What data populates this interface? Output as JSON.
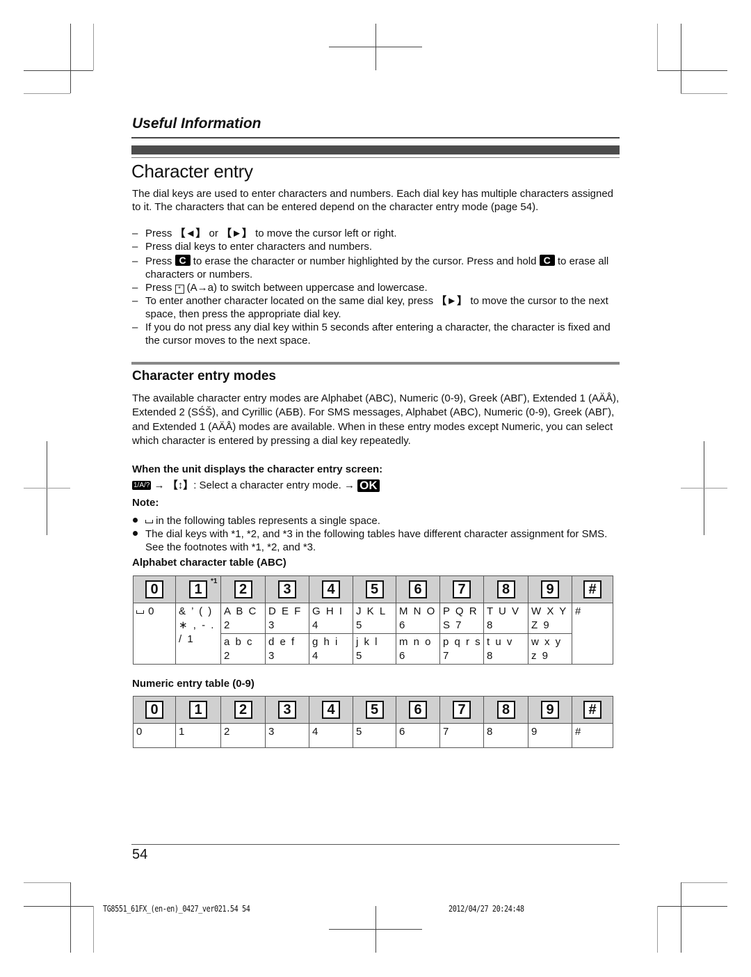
{
  "header": {
    "section_label": "Useful Information",
    "title": "Character entry"
  },
  "intro": {
    "paragraph": "The dial keys are used to enter characters and numbers. Each dial key has multiple characters assigned to it. The characters that can be entered depend on the character entry mode (page 54).",
    "bullets": [
      {
        "pre": "Press ",
        "k1": "【◄】",
        "mid": " or ",
        "k2": "【►】",
        "post": " to move the cursor left or right."
      },
      {
        "text": "Press dial keys to enter characters and numbers."
      },
      {
        "pre": "Press ",
        "key": "C",
        "mid": " to erase the character or number highlighted by the cursor. Press and hold ",
        "key2": "C",
        "post": " to erase all characters or numbers."
      },
      {
        "pre": "Press ",
        "key": "*",
        "post": " (A→a) to switch between uppercase and lowercase."
      },
      {
        "pre": "To enter another character located on the same dial key, press ",
        "key": "【►】",
        "post": " to move the cursor to the next space, then press the appropriate dial key."
      },
      {
        "text": "If you do not press any dial key within 5 seconds after entering a character, the character is fixed and the cursor moves to the next space."
      }
    ]
  },
  "modes": {
    "title": "Character entry modes",
    "paragraph": "The available character entry modes are Alphabet (ABC), Numeric (0-9), Greek (ΑΒΓ), Extended 1 (AÄÅ), Extended 2 (SŚŠ), and Cyrillic (АБВ). For SMS messages, Alphabet (ABC), Numeric (0-9), Greek (ΑΒΓ), and Extended 1 (AÄÅ) modes are available. When in these entry modes except Numeric, you can select which character is entered by pressing a dial key repeatedly.",
    "when_label": "When the unit displays the character entry screen:",
    "step": {
      "mode_key": "1/A/?",
      "arrow": "→",
      "nav_key": "【↕】",
      "text": ": Select a character entry mode. ",
      "ok_key": "OK"
    },
    "note_label": "Note:",
    "notes": [
      " in the following tables represents a single space.",
      "The dial keys with *1, *2, and *3 in the following tables have different character assignment for SMS. See the footnotes with *1, *2, and *3."
    ]
  },
  "alphabet_table": {
    "title": "Alphabet character table (ABC)",
    "keys": [
      "0",
      "1",
      "2",
      "3",
      "4",
      "5",
      "6",
      "7",
      "8",
      "9",
      "#"
    ],
    "key1_footnote": "*1",
    "key0_value": "0",
    "key1_lines": [
      "& ’ ( )",
      "∗ , - .",
      "/ 1"
    ],
    "upper": [
      [
        "A B C",
        "2"
      ],
      [
        "D E F",
        "3"
      ],
      [
        "G H I",
        "4"
      ],
      [
        "J K L",
        "5"
      ],
      [
        "M N O",
        "6"
      ],
      [
        "P Q R",
        "S 7"
      ],
      [
        "T U V",
        "8"
      ],
      [
        "W X Y",
        "Z 9"
      ]
    ],
    "lower": [
      [
        "a b c",
        "2"
      ],
      [
        "d e f",
        "3"
      ],
      [
        "g h i",
        "4"
      ],
      [
        "j k l",
        "5"
      ],
      [
        "m n o",
        "6"
      ],
      [
        "p q r s",
        "7"
      ],
      [
        "t u v",
        "8"
      ],
      [
        "w x y",
        "z 9"
      ]
    ],
    "hash_value": "#"
  },
  "numeric_table": {
    "title": "Numeric entry table (0-9)",
    "keys": [
      "0",
      "1",
      "2",
      "3",
      "4",
      "5",
      "6",
      "7",
      "8",
      "9",
      "#"
    ],
    "values": [
      "0",
      "1",
      "2",
      "3",
      "4",
      "5",
      "6",
      "7",
      "8",
      "9",
      "#"
    ]
  },
  "footer": {
    "page_number": "54",
    "file_info": "TG8551_61FX_(en-en)_0427_ver021.54   54",
    "timestamp": "2012/04/27   20:24:48"
  }
}
